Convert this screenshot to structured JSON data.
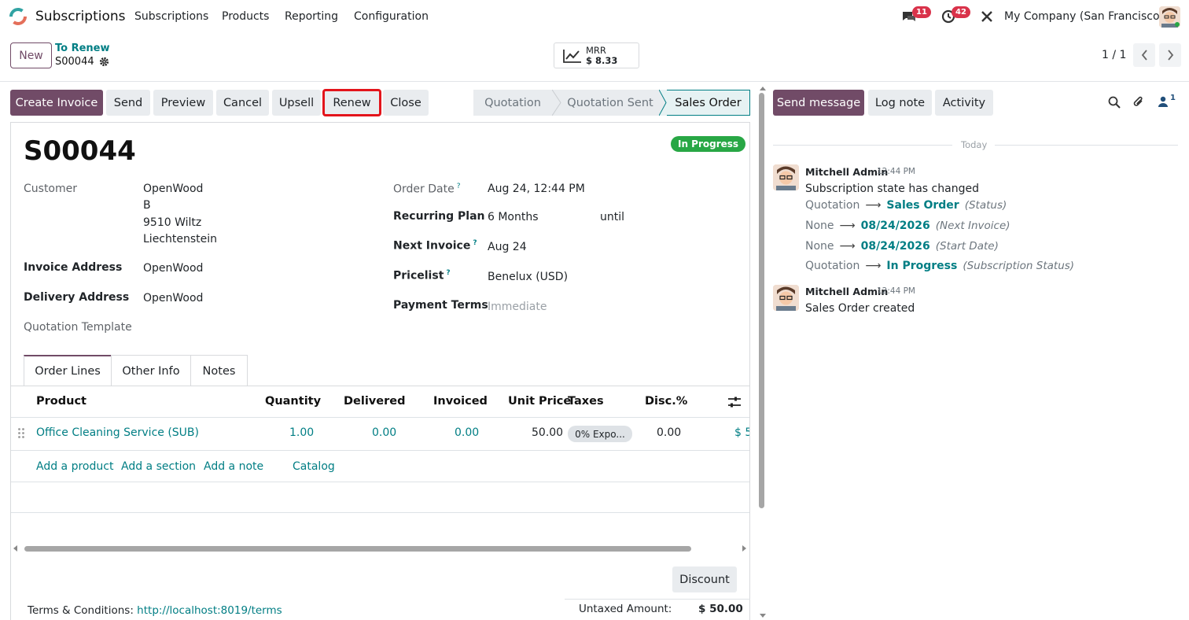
{
  "navbar": {
    "app_name": "Subscriptions",
    "menus": [
      "Subscriptions",
      "Products",
      "Reporting",
      "Configuration"
    ],
    "messages_count": "11",
    "activities_count": "42",
    "company": "My Company (San Francisco)"
  },
  "control_panel": {
    "new_label": "New",
    "breadcrumb_parent": "To Renew",
    "record_name": "S00044",
    "mrr_label": "MRR",
    "mrr_value": "$ 8.33",
    "pager": "1 / 1"
  },
  "form_buttons": {
    "create_invoice": "Create Invoice",
    "send": "Send",
    "preview": "Preview",
    "cancel": "Cancel",
    "upsell": "Upsell",
    "renew": "Renew",
    "close": "Close"
  },
  "statusbar": {
    "stages": [
      "Quotation",
      "Quotation Sent",
      "Sales Order"
    ],
    "active": "Sales Order"
  },
  "form": {
    "title": "S00044",
    "status_badge": "In Progress",
    "customer_label": "Customer",
    "customer_name": "OpenWood",
    "customer_line1": "B",
    "customer_line2": "9510 Wiltz",
    "customer_line3": "Liechtenstein",
    "invoice_address_label": "Invoice Address",
    "invoice_address": "OpenWood",
    "delivery_address_label": "Delivery Address",
    "delivery_address": "OpenWood",
    "quotation_template_label": "Quotation Template",
    "order_date_label": "Order Date",
    "order_date": "Aug 24, 12:44 PM",
    "recurring_plan_label": "Recurring Plan",
    "recurring_plan": "6 Months",
    "until_label": "until",
    "next_invoice_label": "Next Invoice",
    "next_invoice": "Aug 24",
    "pricelist_label": "Pricelist",
    "pricelist": "Benelux (USD)",
    "payment_terms_label": "Payment Terms",
    "payment_terms_placeholder": "Immediate",
    "help_mark": "?"
  },
  "tabs": [
    "Order Lines",
    "Other Info",
    "Notes"
  ],
  "order_table": {
    "headers": [
      "Product",
      "Quantity",
      "Delivered",
      "Invoiced",
      "Unit Price",
      "Taxes",
      "Disc.%"
    ],
    "rows": [
      {
        "product": "Office Cleaning Service (SUB)",
        "quantity": "1.00",
        "delivered": "0.00",
        "invoiced": "0.00",
        "unit_price": "50.00",
        "taxes": "0% Expo...",
        "discount": "0.00",
        "subtotal": "$ 5"
      }
    ],
    "add_links": [
      "Add a product",
      "Add a section",
      "Add a note",
      "Catalog"
    ]
  },
  "footer": {
    "discount_button": "Discount",
    "terms_label": "Terms & Conditions:",
    "terms_link": "http://localhost:8019/terms",
    "untaxed_label": "Untaxed Amount:",
    "untaxed_value": "$ 50.00"
  },
  "chatter": {
    "send_message": "Send message",
    "log_note": "Log note",
    "activity": "Activity",
    "followers_count": "1",
    "date_separator": "Today",
    "messages": [
      {
        "author": "Mitchell Admin",
        "time": "12:44 PM",
        "body": "Subscription state has changed",
        "tracking": [
          {
            "old": "Quotation",
            "new": "Sales Order",
            "field": "(Status)"
          },
          {
            "old": "None",
            "new": "08/24/2026",
            "field": "(Next Invoice)"
          },
          {
            "old": "None",
            "new": "08/24/2026",
            "field": "(Start Date)"
          },
          {
            "old": "Quotation",
            "new": "In Progress",
            "field": "(Subscription Status)"
          }
        ]
      },
      {
        "author": "Mitchell Admin",
        "time": "12:44 PM",
        "body": "Sales Order created",
        "tracking": []
      }
    ]
  },
  "colors": {
    "primary": "#714b67",
    "link": "#017e84",
    "success": "#28a745",
    "badge": "#d9324a",
    "highlight": "#e3141b"
  }
}
